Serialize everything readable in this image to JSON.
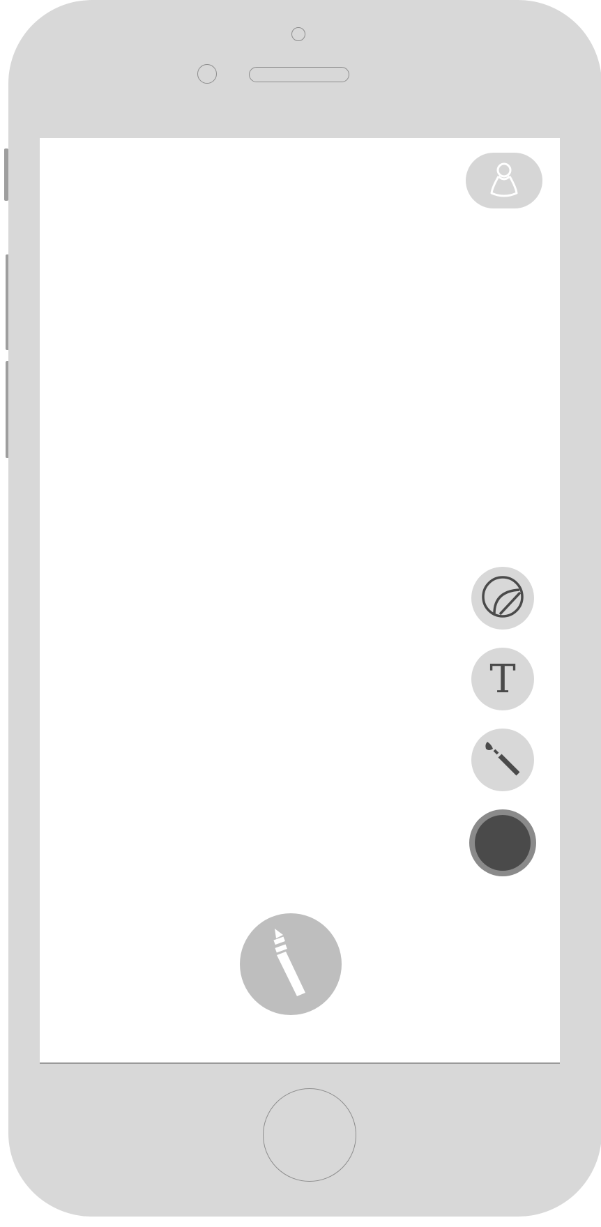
{
  "toolbar": {
    "profile_icon": "user-icon",
    "sticker_icon": "sticker-icon",
    "text_tool_label": "T",
    "brush_icon": "paintbrush-icon",
    "color_picker_icon": "color-swatch",
    "selected_color": "#4a4a4a"
  },
  "main_action": {
    "icon": "marker-icon"
  },
  "colors": {
    "device_frame": "#d8d8d8",
    "screen": "#ffffff",
    "icon_dark": "#4a4a4a",
    "main_action_bg": "#bebebe"
  }
}
